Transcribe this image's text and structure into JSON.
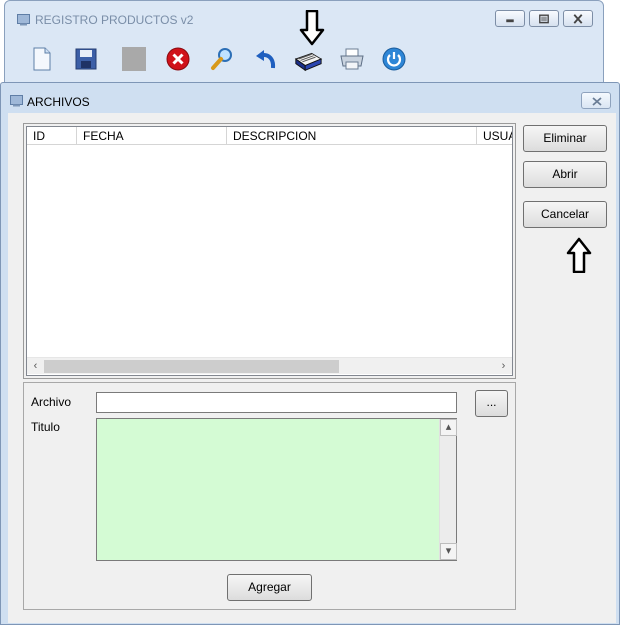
{
  "main_window": {
    "title": "REGISTRO PRODUCTOS v2",
    "toolbar": [
      {
        "icon": "new-document-icon"
      },
      {
        "icon": "save-floppy-icon"
      },
      {
        "icon": "disabled-gray-icon"
      },
      {
        "icon": "delete-red-x-icon"
      },
      {
        "icon": "search-magnifier-icon"
      },
      {
        "icon": "undo-arrow-icon"
      },
      {
        "icon": "money-stack-icon"
      },
      {
        "icon": "printer-icon"
      },
      {
        "icon": "power-icon"
      }
    ]
  },
  "dialog": {
    "title": "ARCHIVOS",
    "grid": {
      "columns": [
        "ID",
        "FECHA",
        "DESCRIPCION",
        "USUA"
      ],
      "rows": []
    },
    "buttons": {
      "eliminar": "Eliminar",
      "abrir": "Abrir",
      "cancelar": "Cancelar",
      "browse": "...",
      "agregar": "Agregar"
    },
    "labels": {
      "archivo": "Archivo",
      "titulo": "Titulo"
    },
    "fields": {
      "archivo_value": "",
      "titulo_value": ""
    }
  },
  "colors": {
    "titulo_background": "#d4fbd4",
    "dialog_frame": "#cfdff1"
  }
}
